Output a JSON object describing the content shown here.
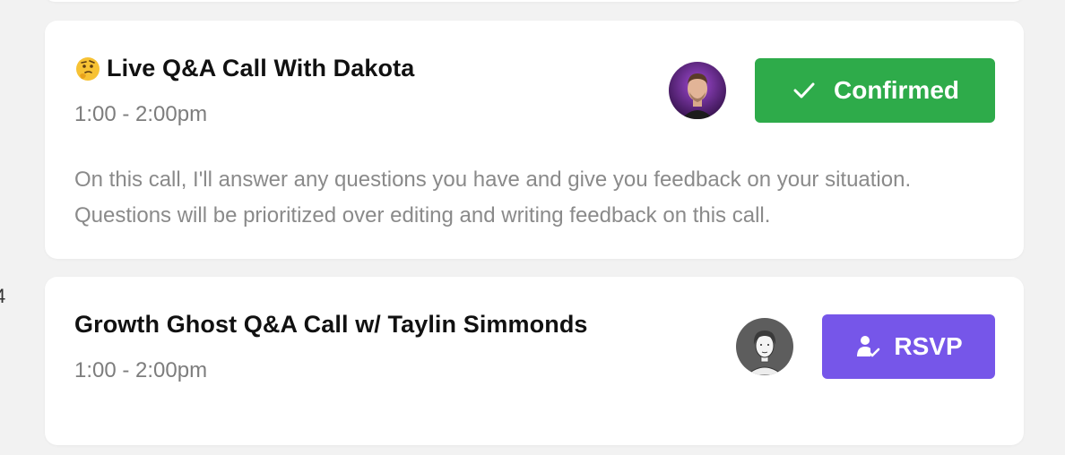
{
  "edge_fragment": "4",
  "events": [
    {
      "emoji": "thinking-face",
      "title": "Live Q&A Call With Dakota",
      "time": "1:00 - 2:00pm",
      "description": "On this call, I'll answer any questions you have and give you feedback on your situation. Questions will be prioritized over editing and writing feedback on this call.",
      "host_avatar": "host-avatar-dakota",
      "action": {
        "label": "Confirmed",
        "icon": "check-icon",
        "color": "#2eab4a"
      }
    },
    {
      "title": "Growth Ghost Q&A Call w/ Taylin Simmonds",
      "time": "1:00 - 2:00pm",
      "host_avatar": "host-avatar-taylin",
      "action": {
        "label": "RSVP",
        "icon": "user-check-icon",
        "color": "#7656e9"
      }
    }
  ]
}
